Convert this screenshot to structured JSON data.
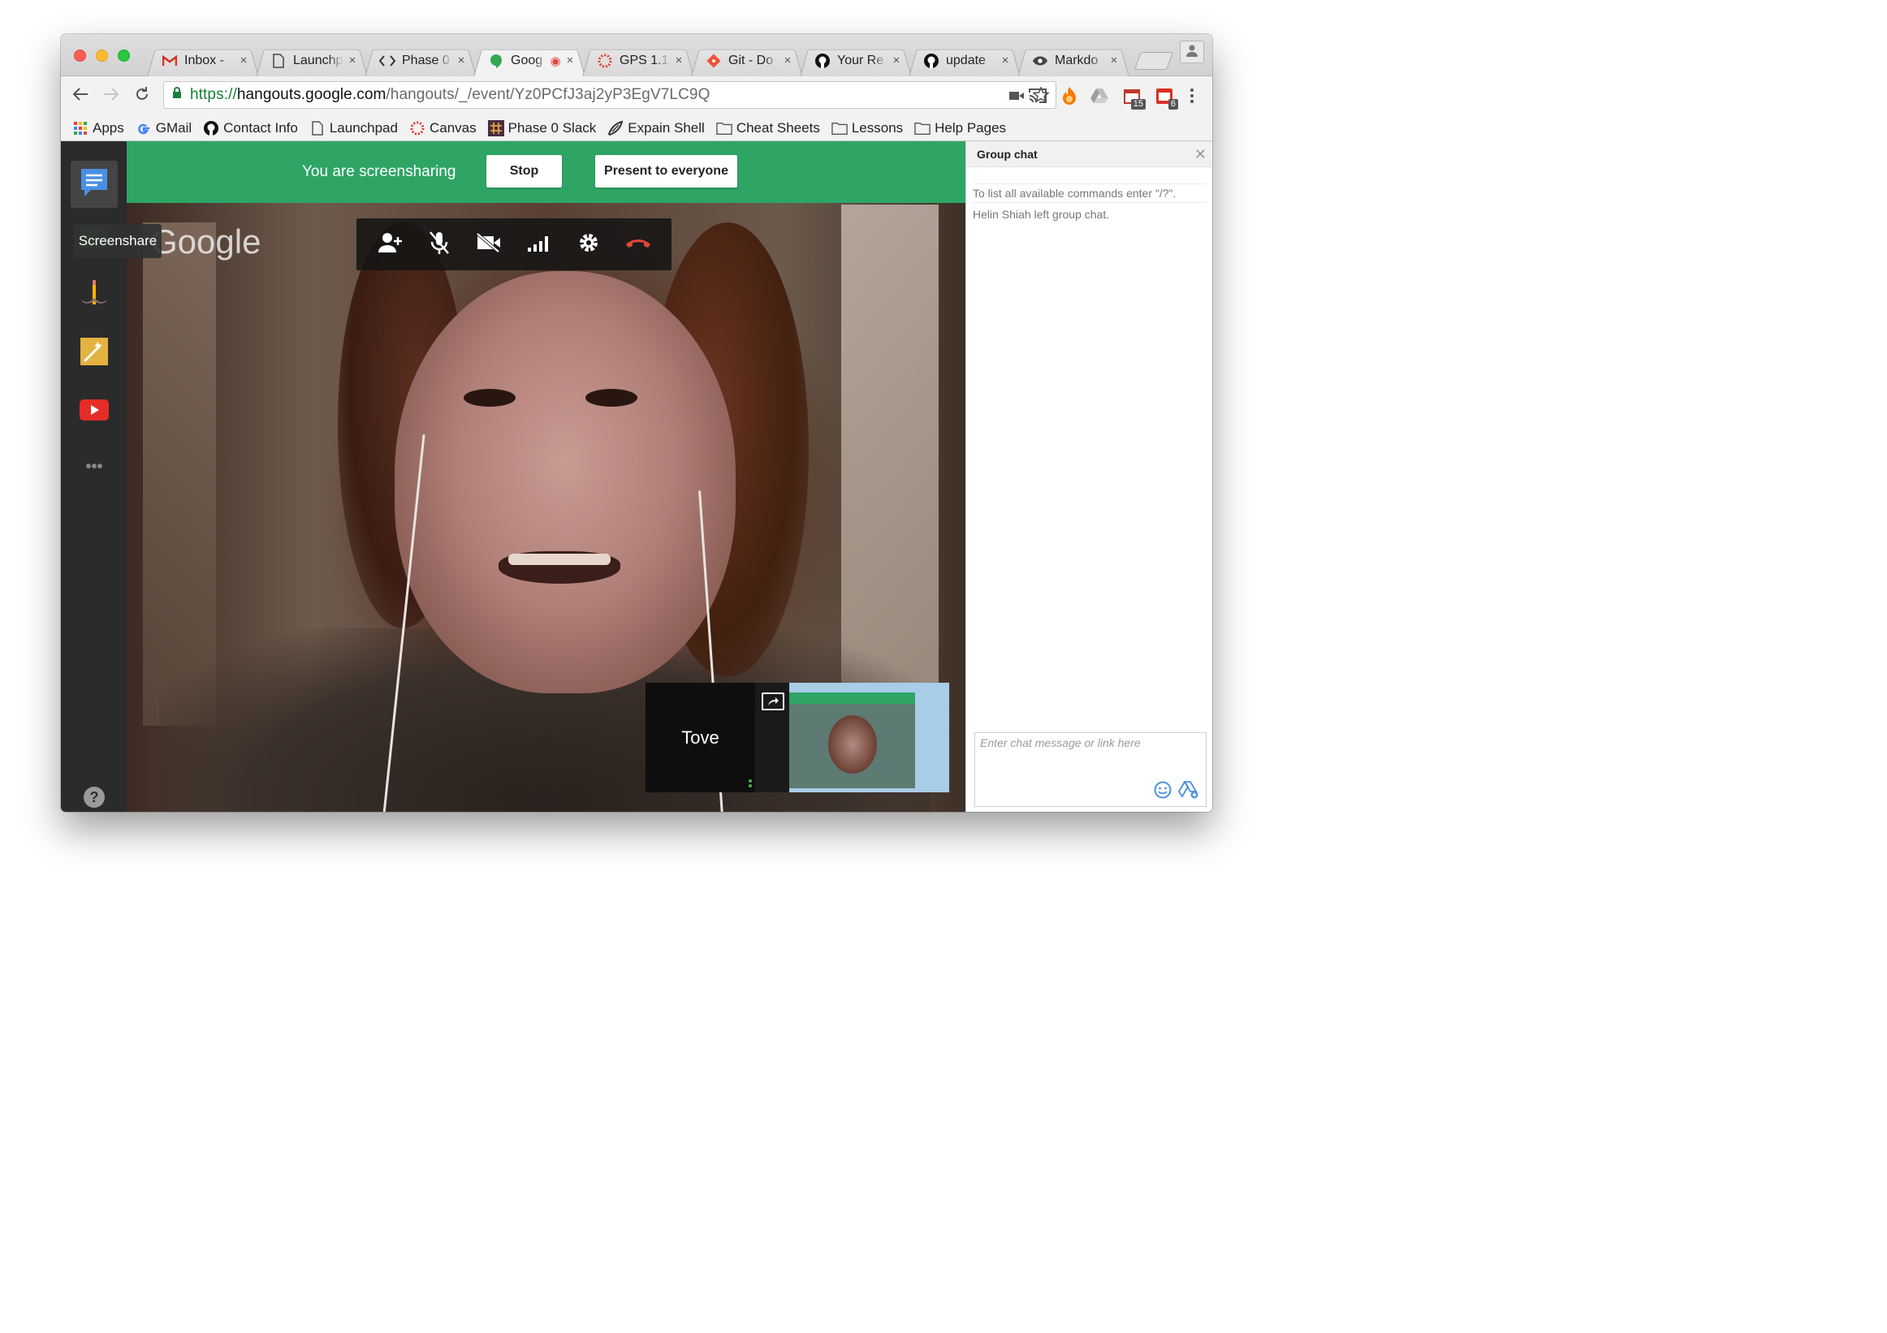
{
  "window": {
    "tabs": [
      {
        "label": "Inbox - ",
        "icon": "gmail-icon"
      },
      {
        "label": "Launchpad",
        "icon": "document-icon"
      },
      {
        "label": "Phase 0",
        "icon": "code-icon"
      },
      {
        "label": "Goog",
        "icon": "hangouts-icon",
        "active": true
      },
      {
        "label": "GPS 1.1",
        "icon": "canvas-icon"
      },
      {
        "label": "Git - Do",
        "icon": "git-icon"
      },
      {
        "label": "Your Re",
        "icon": "github-icon"
      },
      {
        "label": "update",
        "icon": "github-icon"
      },
      {
        "label": "Markdo",
        "icon": "eye-icon"
      }
    ],
    "tab_close_glyph": "×"
  },
  "toolbar": {
    "url_scheme": "https://",
    "url_host": "hangouts.google.com",
    "url_path": "/hangouts/_/event/Yz0PCfJ3aj2yP3EgV7LC9Q",
    "ext_badge_1": "15",
    "ext_badge_2": "6"
  },
  "bookmarks": [
    {
      "label": "Apps",
      "icon": "apps-grid-icon"
    },
    {
      "label": "GMail",
      "icon": "google-g-icon"
    },
    {
      "label": "Contact Info",
      "icon": "github-icon"
    },
    {
      "label": "Launchpad",
      "icon": "document-icon"
    },
    {
      "label": "Canvas",
      "icon": "canvas-icon"
    },
    {
      "label": "Phase 0 Slack",
      "icon": "slack-hash-icon"
    },
    {
      "label": "Expain Shell",
      "icon": "shell-icon"
    },
    {
      "label": "Cheat Sheets",
      "icon": "folder-icon"
    },
    {
      "label": "Lessons",
      "icon": "folder-icon"
    },
    {
      "label": "Help Pages",
      "icon": "folder-icon"
    }
  ],
  "hangout": {
    "screenshare_message": "You are screensharing",
    "stop_label": "Stop",
    "present_label": "Present to everyone",
    "tooltip": "Screenshare",
    "watermark": "Google",
    "participant_name": "Tove",
    "help_glyph": "?",
    "more_glyph": "•••"
  },
  "chat": {
    "title": "Group chat",
    "close_glyph": "✕",
    "messages": [
      "To list all available commands enter \"/?\".",
      "Helin Shiah left group chat."
    ],
    "input_placeholder": "Enter chat message or link here"
  },
  "colors": {
    "screenshare_bar": "#2ea565",
    "hangup_red": "#e0453a",
    "sidebar_dark": "#2b2b2b"
  }
}
